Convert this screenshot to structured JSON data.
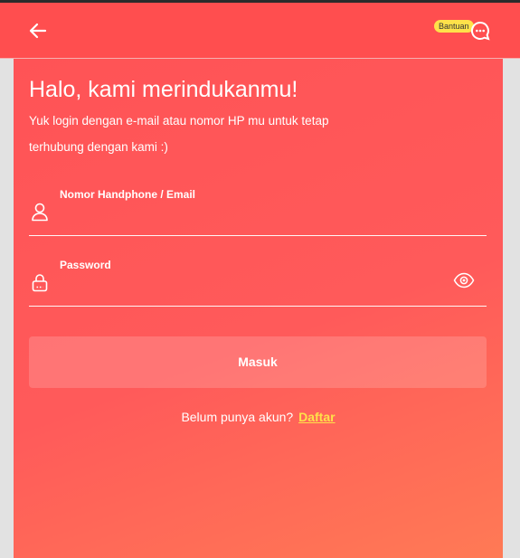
{
  "header": {
    "help_label": "Bantuan",
    "accent_color": "#ff4e4f",
    "back_icon": "arrow-left-icon",
    "help_icon": "chat-bubble-icon"
  },
  "login": {
    "title": "Halo, kami merindukanmu!",
    "subtitle": "Yuk login dengan e-mail atau nomor HP mu untuk tetap terhubung dengan kami :)",
    "fields": [
      {
        "label": "Nomor Handphone / Email",
        "value": "",
        "icon": "user-icon"
      },
      {
        "label": "Password",
        "value": "",
        "icon": "lock-icon",
        "toggle_icon": "eye-icon"
      }
    ],
    "submit_label": "Masuk",
    "signup_prompt": "Belum punya akun?",
    "signup_link": "Daftar",
    "link_color": "#ffe14a"
  }
}
